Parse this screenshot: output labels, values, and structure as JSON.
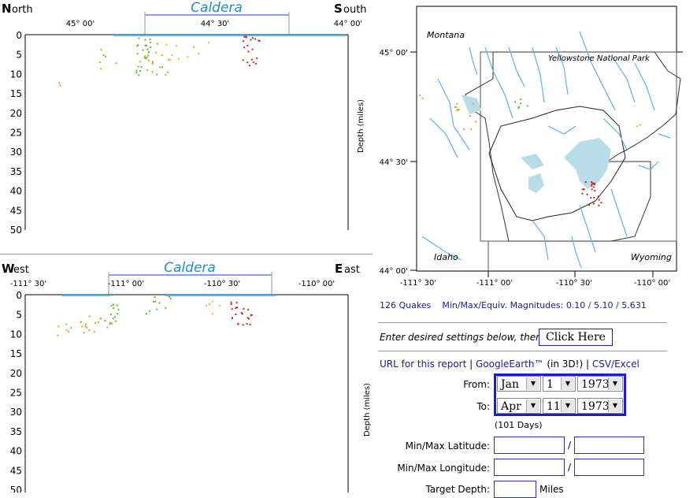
{
  "ns_section": {
    "north_letter": "N",
    "north_rest": "orth",
    "south_letter": "S",
    "south_rest": "outh",
    "caldera": "Caldera",
    "top_ticks": [
      "45° 00'",
      "44° 30'",
      "44° 00'"
    ],
    "depths": [
      "0",
      "5",
      "10",
      "15",
      "20",
      "25",
      "30",
      "35",
      "40",
      "45",
      "50"
    ],
    "ylabel": "Depth (miles)"
  },
  "we_section": {
    "west_letter": "W",
    "west_rest": "est",
    "east_letter": "E",
    "east_rest": "ast",
    "caldera": "Caldera",
    "top_ticks": [
      "-111° 30'",
      "-111° 00'",
      "-110° 30'",
      "-110° 00'"
    ],
    "depths": [
      "0",
      "5",
      "10",
      "15",
      "20",
      "25",
      "30",
      "35",
      "40",
      "45",
      "50"
    ],
    "ylabel": "Depth (miles)"
  },
  "map": {
    "montana": "Montana",
    "park": "Yellowstone National Park",
    "idaho": "Idaho",
    "wyoming": "Wyoming",
    "lat_ticks": [
      "45° 00'",
      "44° 30'",
      "44° 00'"
    ],
    "lon_ticks": [
      "-111° 30'",
      "-111° 00'",
      "-110° 30'",
      "-110° 00'"
    ]
  },
  "summary": "126 Quakes    Min/Max/Equiv. Magnitudes: 0.10 / 5.10 / 5.631",
  "settings_prompt": "Enter desired settings below, then",
  "click_here": "Click Here",
  "links": {
    "url_report": "URL for this report",
    "sep1": "|",
    "google_earth": "GoogleEarth™",
    "in3d": "(in 3D!)",
    "sep2": "|",
    "csv": "CSV/Excel"
  },
  "form": {
    "from_label": "From:",
    "to_label": "To:",
    "from": {
      "month": "Jan",
      "day": "1",
      "year": "1973"
    },
    "to": {
      "month": "Apr",
      "day": "11",
      "year": "1973"
    },
    "days": "(101 Days)",
    "lat_label": "Min/Max Latitude:",
    "lon_label": "Min/Max Longitude:",
    "depth_label": "Target Depth:",
    "slash": "/",
    "miles": "Miles",
    "lat_min": "",
    "lat_max": "",
    "lon_min": "",
    "lon_max": "",
    "depth": ""
  },
  "colors": {
    "caldera": "#1c8fc0",
    "water": "#5ab4e8",
    "lake": "#b9dde8",
    "form_border": "#1a1ae0"
  }
}
